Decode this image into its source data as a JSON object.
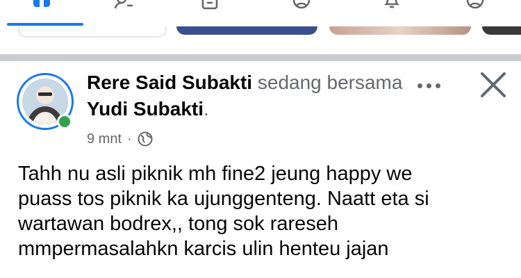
{
  "nav": {
    "items": [
      {
        "icon": "home-icon",
        "active": true
      },
      {
        "icon": "friends-icon"
      },
      {
        "icon": "marketplace-icon"
      },
      {
        "icon": "profile-icon"
      },
      {
        "icon": "notifications-bell-icon"
      },
      {
        "icon": "menu-avatar-icon"
      }
    ],
    "accent": "#1877f2"
  },
  "post": {
    "author": "Rere Said Subakti",
    "with_text": "sedang bersama",
    "tagged": "Yudi Subakti",
    "period": ".",
    "time": "9 mnt",
    "separator": "·",
    "audience_icon": "globe-icon",
    "online_color": "#31a24c",
    "body_lines": [
      "Tahh nu asli piknik mh fine2 jeung happy we",
      "puass tos piknik ka ujunggenteng. Naatt eta si",
      "wartawan bodrex,, tong sok rareseh",
      "mmpermasalahkn karcis ulin henteu jajan"
    ]
  }
}
